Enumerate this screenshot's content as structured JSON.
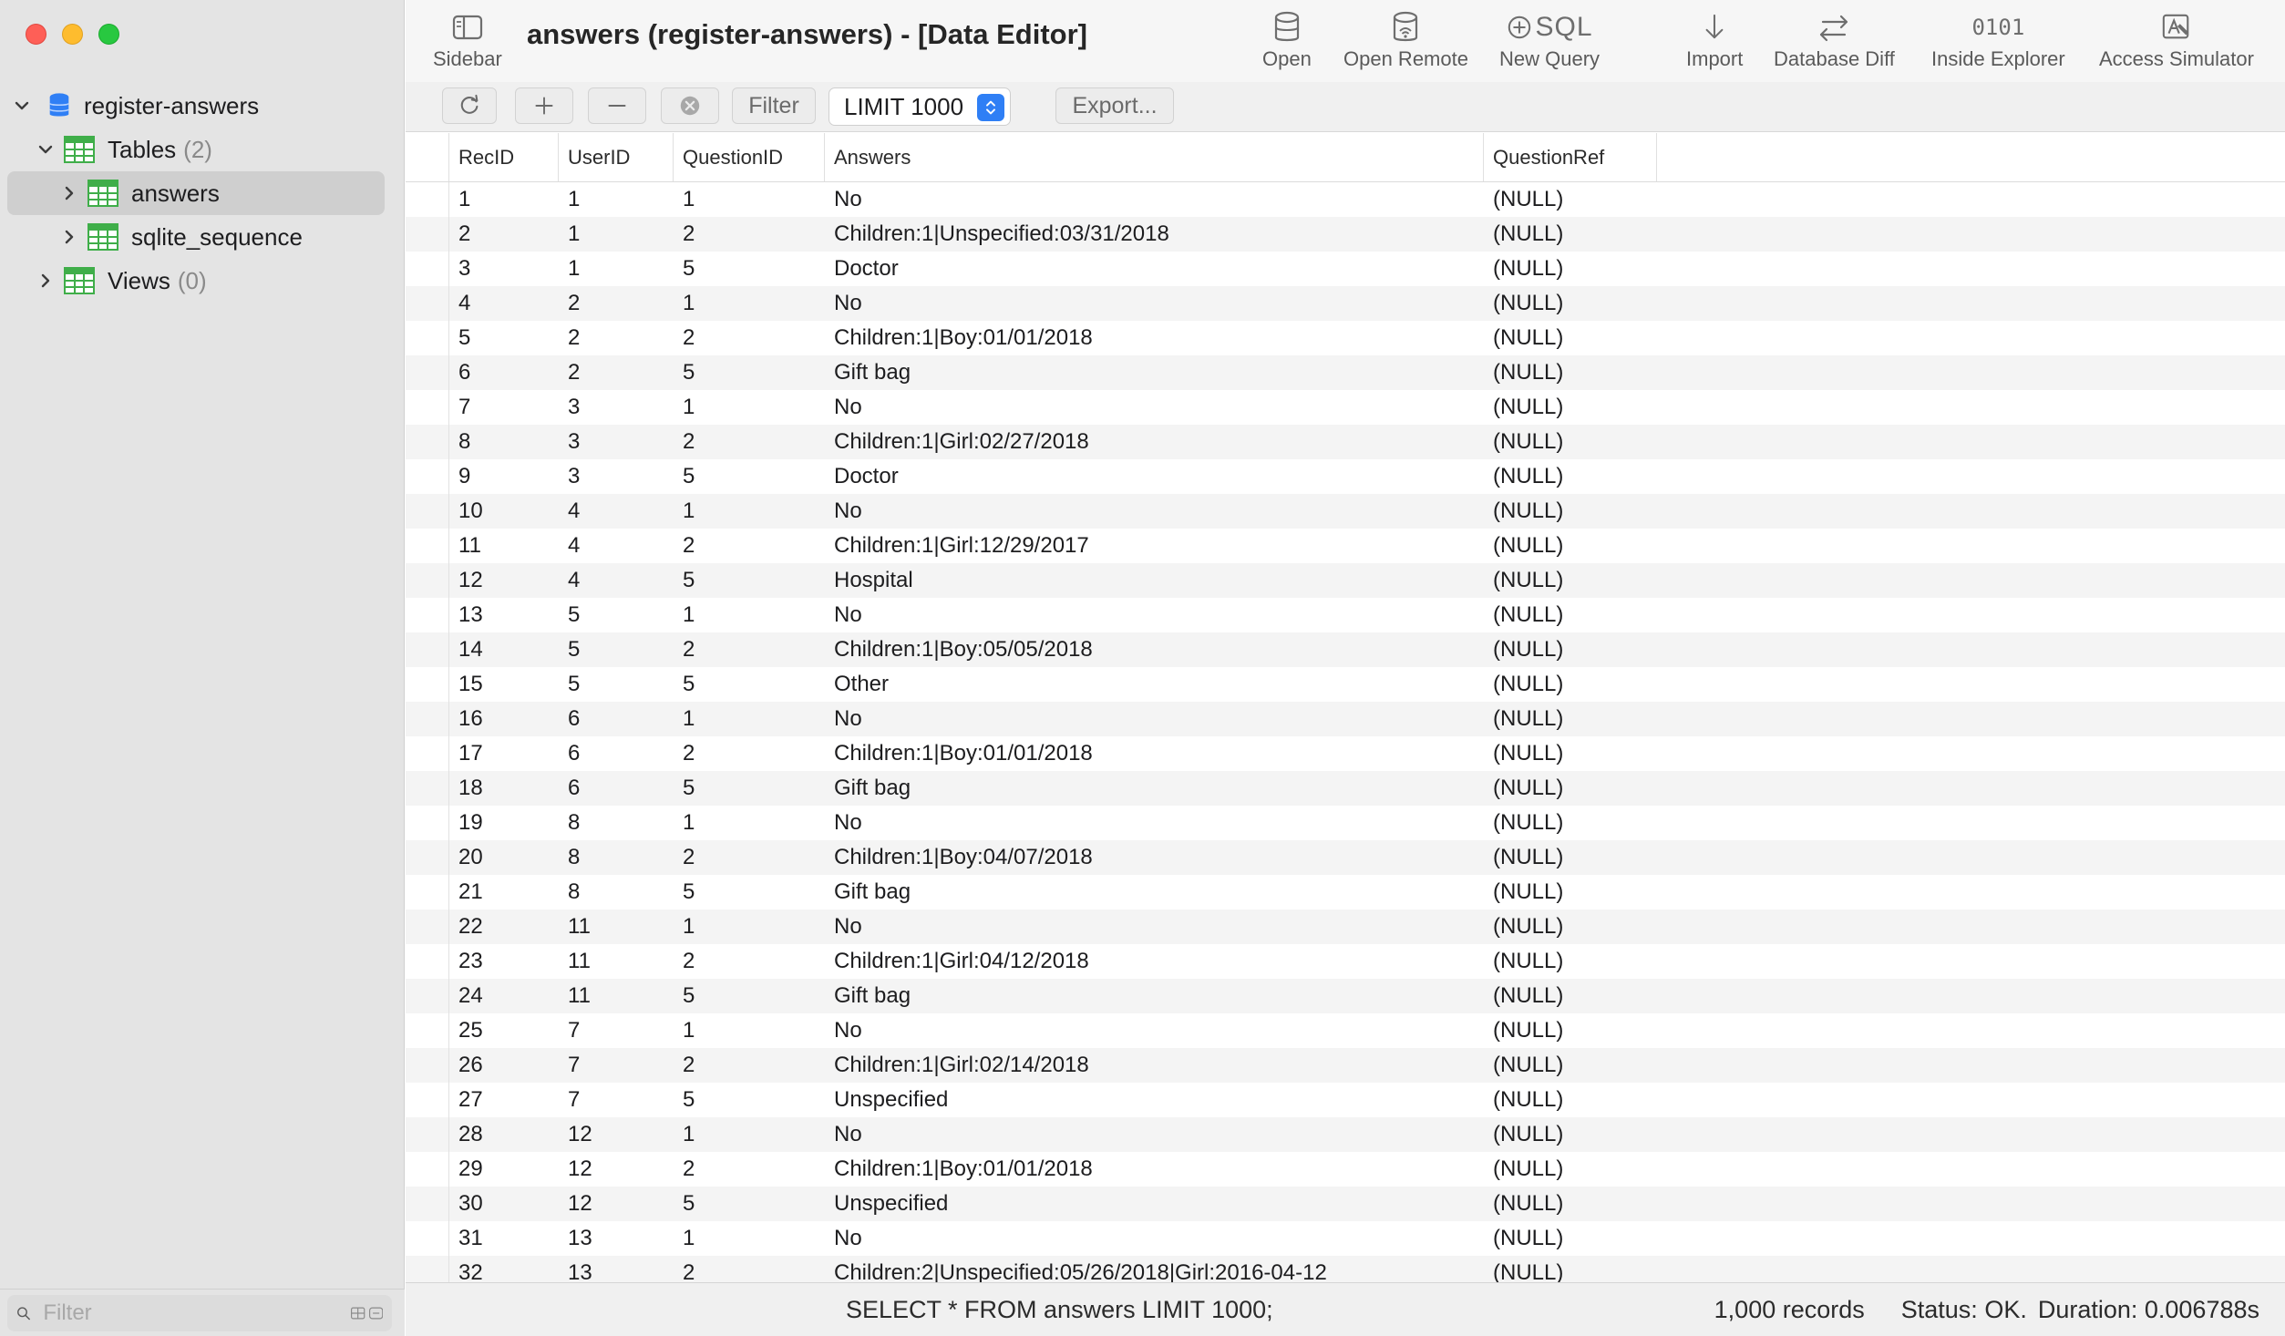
{
  "window": {
    "title": "answers (register-answers) - [Data Editor]"
  },
  "toolbar": {
    "sidebar": "Sidebar",
    "open": "Open",
    "open_remote": "Open Remote",
    "new_query": "New Query",
    "new_query_icon_text": "SQL",
    "import": "Import",
    "database_diff": "Database Diff",
    "inside_explorer": "Inside Explorer",
    "inside_explorer_icon_text": "0101",
    "access_simulator": "Access Simulator"
  },
  "subbar": {
    "filter": "Filter",
    "limit": "LIMIT 1000",
    "export": "Export..."
  },
  "sidebar": {
    "database": "register-answers",
    "tables_label": "Tables",
    "tables_count": "(2)",
    "table_1": "answers",
    "table_2": "sqlite_sequence",
    "views_label": "Views",
    "views_count": "(0)",
    "filter_placeholder": "Filter"
  },
  "columns": [
    "RecID",
    "UserID",
    "QuestionID",
    "Answers",
    "QuestionRef"
  ],
  "rows": [
    [
      "1",
      "1",
      "1",
      "No",
      "(NULL)"
    ],
    [
      "2",
      "1",
      "2",
      "Children:1|Unspecified:03/31/2018",
      "(NULL)"
    ],
    [
      "3",
      "1",
      "5",
      "Doctor",
      "(NULL)"
    ],
    [
      "4",
      "2",
      "1",
      "No",
      "(NULL)"
    ],
    [
      "5",
      "2",
      "2",
      "Children:1|Boy:01/01/2018",
      "(NULL)"
    ],
    [
      "6",
      "2",
      "5",
      "Gift bag",
      "(NULL)"
    ],
    [
      "7",
      "3",
      "1",
      "No",
      "(NULL)"
    ],
    [
      "8",
      "3",
      "2",
      "Children:1|Girl:02/27/2018",
      "(NULL)"
    ],
    [
      "9",
      "3",
      "5",
      "Doctor",
      "(NULL)"
    ],
    [
      "10",
      "4",
      "1",
      "No",
      "(NULL)"
    ],
    [
      "11",
      "4",
      "2",
      "Children:1|Girl:12/29/2017",
      "(NULL)"
    ],
    [
      "12",
      "4",
      "5",
      "Hospital",
      "(NULL)"
    ],
    [
      "13",
      "5",
      "1",
      "No",
      "(NULL)"
    ],
    [
      "14",
      "5",
      "2",
      "Children:1|Boy:05/05/2018",
      "(NULL)"
    ],
    [
      "15",
      "5",
      "5",
      "Other",
      "(NULL)"
    ],
    [
      "16",
      "6",
      "1",
      "No",
      "(NULL)"
    ],
    [
      "17",
      "6",
      "2",
      "Children:1|Boy:01/01/2018",
      "(NULL)"
    ],
    [
      "18",
      "6",
      "5",
      "Gift bag",
      "(NULL)"
    ],
    [
      "19",
      "8",
      "1",
      "No",
      "(NULL)"
    ],
    [
      "20",
      "8",
      "2",
      "Children:1|Boy:04/07/2018",
      "(NULL)"
    ],
    [
      "21",
      "8",
      "5",
      "Gift bag",
      "(NULL)"
    ],
    [
      "22",
      "11",
      "1",
      "No",
      "(NULL)"
    ],
    [
      "23",
      "11",
      "2",
      "Children:1|Girl:04/12/2018",
      "(NULL)"
    ],
    [
      "24",
      "11",
      "5",
      "Gift bag",
      "(NULL)"
    ],
    [
      "25",
      "7",
      "1",
      "No",
      "(NULL)"
    ],
    [
      "26",
      "7",
      "2",
      "Children:1|Girl:02/14/2018",
      "(NULL)"
    ],
    [
      "27",
      "7",
      "5",
      "Unspecified",
      "(NULL)"
    ],
    [
      "28",
      "12",
      "1",
      "No",
      "(NULL)"
    ],
    [
      "29",
      "12",
      "2",
      "Children:1|Boy:01/01/2018",
      "(NULL)"
    ],
    [
      "30",
      "12",
      "5",
      "Unspecified",
      "(NULL)"
    ],
    [
      "31",
      "13",
      "1",
      "No",
      "(NULL)"
    ],
    [
      "32",
      "13",
      "2",
      "Children:2|Unspecified:05/26/2018|Girl:2016-04-12",
      "(NULL)"
    ]
  ],
  "status": {
    "query": "SELECT * FROM answers LIMIT 1000;",
    "records": "1,000 records",
    "state": "Status: OK.",
    "duration": "Duration: 0.006788s"
  },
  "colors": {
    "accent": "#2f7ff5",
    "table_icon": "#3fae49",
    "db_icon": "#2f7ff5"
  }
}
